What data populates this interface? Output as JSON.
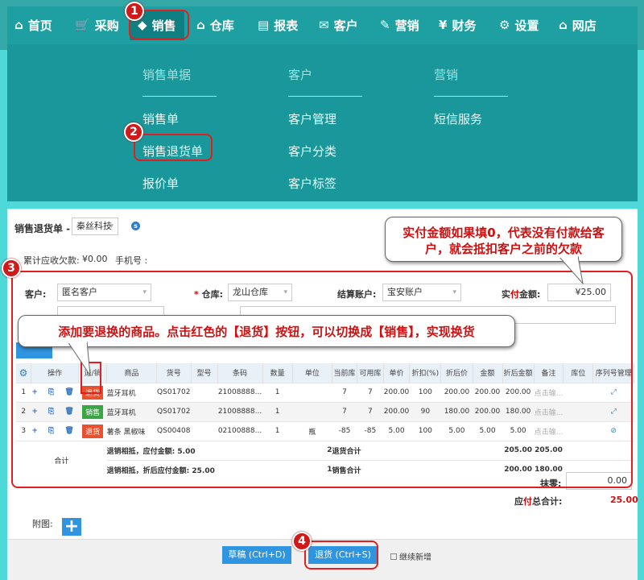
{
  "topnav": {
    "items": [
      {
        "icon": "home-icon",
        "glyph": "⌂",
        "label": "首页"
      },
      {
        "icon": "cart-icon",
        "glyph": "🛒",
        "label": "采购"
      },
      {
        "icon": "tag-icon",
        "glyph": "◆",
        "label": "销售"
      },
      {
        "icon": "warehouse-icon",
        "glyph": "⌂",
        "label": "仓库"
      },
      {
        "icon": "clipboard-icon",
        "glyph": "▤",
        "label": "报表"
      },
      {
        "icon": "mail-icon",
        "glyph": "✉",
        "label": "客户"
      },
      {
        "icon": "coupon-icon",
        "glyph": "✎",
        "label": "营销"
      },
      {
        "icon": "yen-icon",
        "glyph": "¥",
        "label": "财务"
      },
      {
        "icon": "gear-icon",
        "glyph": "⚙",
        "label": "设置"
      },
      {
        "icon": "home-outline-icon",
        "glyph": "⌂",
        "label": "网店"
      }
    ]
  },
  "megamenu": {
    "col1": {
      "head": "销售单据",
      "items": [
        "销售单",
        "销售退货单",
        "报价单"
      ]
    },
    "col2": {
      "head": "客户",
      "items": [
        "客户管理",
        "客户分类",
        "客户标签"
      ]
    },
    "col3": {
      "head": "营销",
      "items": [
        "短信服务"
      ]
    }
  },
  "badges": [
    "1",
    "2",
    "3",
    "4"
  ],
  "callouts": {
    "top": "实付金额如果填0，代表没有付款给客户，就会抵扣客户之前的欠款",
    "middle": "添加要退换的商品。点击红色的【退货】按钮，可以切换成【销售】，实现换货"
  },
  "form": {
    "doc_title": "销售退货单 - -",
    "company": "秦丝科技",
    "info_icon": "s",
    "debt_label": "累计应收欠款: ",
    "debt_value": "¥0.00",
    "phone_label": "手机号 :",
    "customer_label": "客户:",
    "customer_value": "匿名客户",
    "warehouse_star": "*",
    "warehouse_label": "仓库:",
    "warehouse_value": "龙山仓库",
    "account_label": "结算账户:",
    "account_value": "宝安账户",
    "paid_label_a": "实",
    "paid_label_b": "付",
    "paid_label_c": "金额:",
    "paid_value": "¥25.00"
  },
  "table": {
    "headers": [
      "操作",
      "退/销",
      "商品",
      "货号",
      "型号",
      "条码",
      "数量",
      "单位",
      "当前库",
      "可用库",
      "单价",
      "折扣(%)",
      "折后价",
      "金额",
      "折后金额",
      "备注",
      "库位",
      "序列号管理"
    ],
    "rows": [
      {
        "idx": "1",
        "ops": "+ ⎘ 🗑",
        "type": "退货",
        "type_color": "red",
        "product": "蓝牙耳机",
        "sku": "QS01702",
        "model": "",
        "barcode": "21008888...",
        "qty": "1",
        "unit": "",
        "stock": "7",
        "avail": "7",
        "price": "200.00",
        "discount": "100",
        "after_price": "200.00",
        "amount": "200.00",
        "after_amount": "200.00",
        "remark": "点击输...",
        "location": "",
        "serial": "⤢"
      },
      {
        "idx": "2",
        "ops": "+ ⎘ 🗑",
        "type": "销售",
        "type_color": "green",
        "product": "蓝牙耳机",
        "sku": "QS01702",
        "model": "",
        "barcode": "21008888...",
        "qty": "1",
        "unit": "",
        "stock": "7",
        "avail": "7",
        "price": "200.00",
        "discount": "90",
        "after_price": "180.00",
        "amount": "200.00",
        "after_amount": "180.00",
        "remark": "点击输...",
        "location": "",
        "serial": "⤢"
      },
      {
        "idx": "3",
        "ops": "+ ⎘ 🗑",
        "type": "退货",
        "type_color": "red",
        "product": "薯条 黑椒味",
        "sku": "QS00408",
        "model": "",
        "barcode": "02100888...",
        "qty": "1",
        "unit": "瓶",
        "stock": "-85",
        "avail": "-85",
        "price": "5.00",
        "discount": "100",
        "after_price": "5.00",
        "amount": "5.00",
        "after_amount": "5.00",
        "remark": "点击输...",
        "location": "",
        "serial": "⊘"
      }
    ],
    "summary": {
      "label": "合计",
      "line1": "退销相抵，应付金额: 5.00",
      "line2": "退销相抵，折后应付金额: 25.00",
      "qty_return": "2",
      "qty_sale": "1",
      "return_total_label": "退货合计",
      "sale_total_label": "销售合计",
      "return_amount": "205.00",
      "return_after": "205.00",
      "sale_amount": "200.00",
      "sale_after": "180.00"
    }
  },
  "footer": {
    "rounding_label": "抹零:",
    "rounding_value": "0.00",
    "total_label_a": "应",
    "total_label_b": "付",
    "total_label_c": "总合计:",
    "total_value": "25.00",
    "attach_label": "附图:",
    "draft_button": "草稿 (Ctrl+D)",
    "return_button": "退货 (Ctrl+S)",
    "continue_label": "继续新增"
  }
}
